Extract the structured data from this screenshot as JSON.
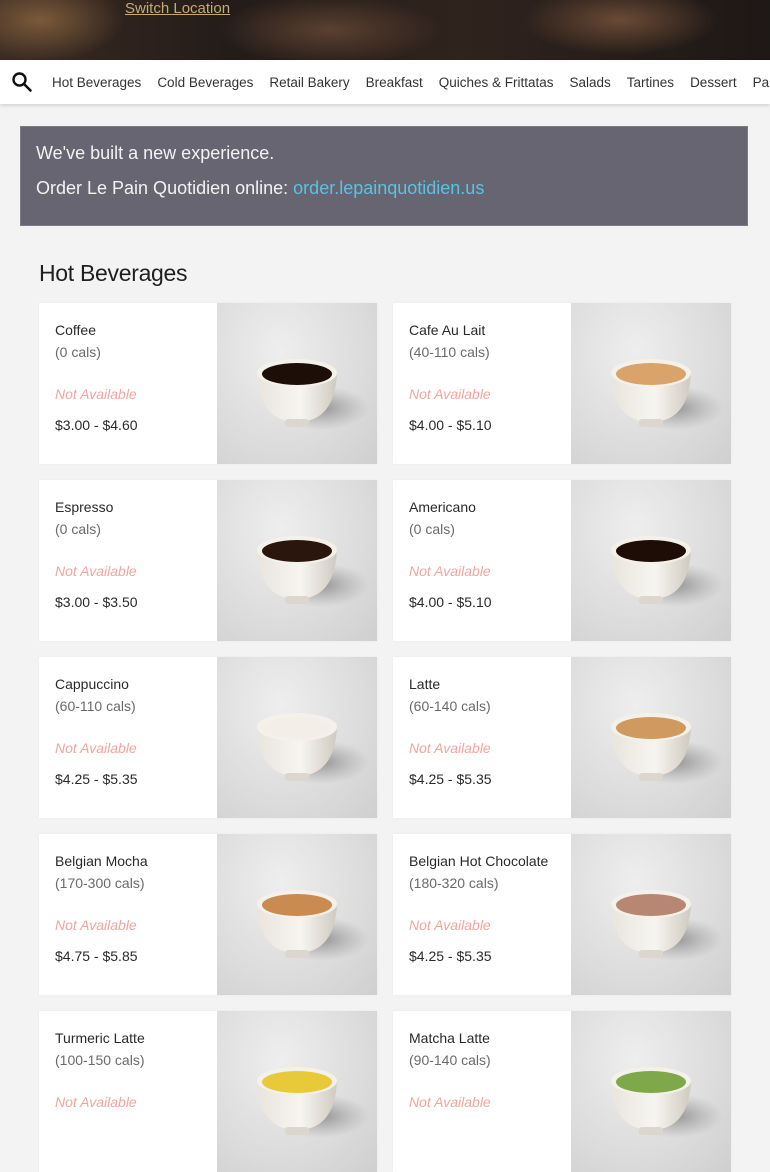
{
  "hero": {
    "switch_location": "Switch Location"
  },
  "nav": {
    "items": [
      "Hot Beverages",
      "Cold Beverages",
      "Retail Bakery",
      "Breakfast",
      "Quiches & Frittatas",
      "Salads",
      "Tartines",
      "Dessert",
      "Pantry"
    ]
  },
  "banner": {
    "line1": "We've built a new experience.",
    "line2_prefix": "Order Le Pain Quotidien online: ",
    "link": "order.lepainquotidien.us",
    "bg_color": "#686572",
    "link_color": "#59c3e3"
  },
  "section": {
    "title": "Hot Beverages"
  },
  "items": [
    {
      "name": "Coffee",
      "cals": "(0 cals)",
      "availability": "Not Available",
      "price": "$3.00 - $4.60",
      "drink_color": "#1d0f08",
      "icon": "coffee-cup-photo"
    },
    {
      "name": "Cafe Au Lait",
      "cals": "(40-110 cals)",
      "availability": "Not Available",
      "price": "$4.00 - $5.10",
      "drink_color": "#d9a36a",
      "icon": "cafe-au-lait-cup-photo"
    },
    {
      "name": "Espresso",
      "cals": "(0 cals)",
      "availability": "Not Available",
      "price": "$3.00 - $3.50",
      "drink_color": "#2a160d",
      "icon": "espresso-cup-photo"
    },
    {
      "name": "Americano",
      "cals": "(0 cals)",
      "availability": "Not Available",
      "price": "$4.00 - $5.10",
      "drink_color": "#1e0d06",
      "icon": "americano-cup-photo"
    },
    {
      "name": "Cappuccino",
      "cals": "(60-110 cals)",
      "availability": "Not Available",
      "price": "$4.25 - $5.35",
      "drink_color": "#f3efe8",
      "icon": "cappuccino-cup-photo"
    },
    {
      "name": "Latte",
      "cals": "(60-140 cals)",
      "availability": "Not Available",
      "price": "$4.25 - $5.35",
      "drink_color": "#cf995f",
      "icon": "latte-cup-photo"
    },
    {
      "name": "Belgian Mocha",
      "cals": "(170-300 cals)",
      "availability": "Not Available",
      "price": "$4.75 - $5.85",
      "drink_color": "#c98b4f",
      "icon": "mocha-cup-photo"
    },
    {
      "name": "Belgian Hot Chocolate",
      "cals": "(180-320 cals)",
      "availability": "Not Available",
      "price": "$4.25 - $5.35",
      "drink_color": "#b88773",
      "icon": "hot-chocolate-cup-photo"
    },
    {
      "name": "Turmeric Latte",
      "cals": "(100-150 cals)",
      "availability": "Not Available",
      "price": "",
      "drink_color": "#e8c93a",
      "icon": "turmeric-latte-cup-photo"
    },
    {
      "name": "Matcha Latte",
      "cals": "(90-140 cals)",
      "availability": "Not Available",
      "price": "",
      "drink_color": "#7fa84a",
      "icon": "matcha-latte-cup-photo"
    }
  ]
}
